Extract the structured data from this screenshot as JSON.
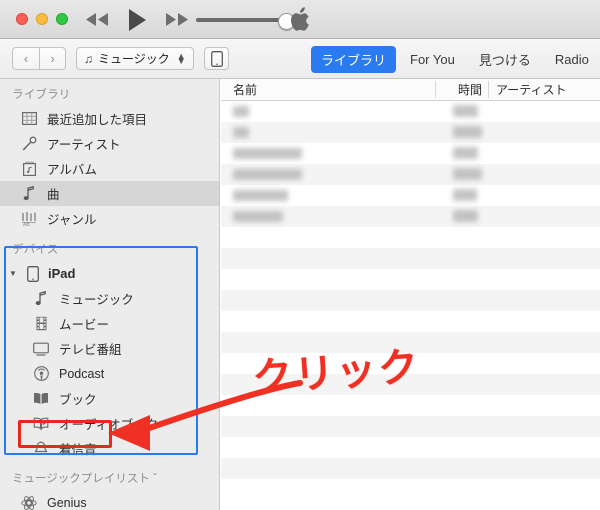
{
  "window": {
    "traffic_lights": [
      {
        "name": "close",
        "color": "#fb5f57"
      },
      {
        "name": "minimize",
        "color": "#fdbc40"
      },
      {
        "name": "zoom",
        "color": "#33c748"
      }
    ],
    "transport": [
      {
        "name": "rewind",
        "icon": "rewind-icon"
      },
      {
        "name": "play",
        "icon": "play-icon"
      },
      {
        "name": "fast-forward",
        "icon": "fast-forward-icon"
      }
    ],
    "volume": {
      "value": 100,
      "label": "volume-slider"
    },
    "apple_logo": ""
  },
  "toolbar": {
    "back_label": "‹",
    "forward_label": "›",
    "source_popup": {
      "label": "ミュージック",
      "icon": "music-note-icon"
    },
    "device_button_icon": "ipad-icon",
    "tabs": [
      {
        "label": "ライブラリ",
        "active": true
      },
      {
        "label": "For You",
        "active": false
      },
      {
        "label": "見つける",
        "active": false
      },
      {
        "label": "Radio",
        "active": false
      }
    ],
    "accent_color": "#2a7bf0"
  },
  "sidebar": {
    "library_header": "ライブラリ",
    "library_items": [
      {
        "label": "最近追加した項目",
        "icon": "grid-icon",
        "selected": false
      },
      {
        "label": "アーティスト",
        "icon": "microphone-icon",
        "selected": false
      },
      {
        "label": "アルバム",
        "icon": "album-icon",
        "selected": false
      },
      {
        "label": "曲",
        "icon": "music-note-icon",
        "selected": true
      },
      {
        "label": "ジャンル",
        "icon": "genre-icon",
        "selected": false
      }
    ],
    "devices_header": "デバイス",
    "device": {
      "label": "iPad",
      "icon": "ipad-icon",
      "expanded": true
    },
    "device_items": [
      {
        "label": "ミュージック",
        "icon": "music-note-icon",
        "highlighted": false
      },
      {
        "label": "ムービー",
        "icon": "film-icon",
        "highlighted": false
      },
      {
        "label": "テレビ番組",
        "icon": "tv-icon",
        "highlighted": false
      },
      {
        "label": "Podcast",
        "icon": "podcast-icon",
        "highlighted": false
      },
      {
        "label": "ブック",
        "icon": "book-icon",
        "highlighted": false
      },
      {
        "label": "オーディオブック",
        "icon": "audiobook-icon",
        "highlighted": false
      },
      {
        "label": "着信音",
        "icon": "bell-icon",
        "highlighted": true
      }
    ],
    "playlists_header": "ミュージックプレイリスト ˇ",
    "playlist_items": [
      {
        "label": "Genius",
        "icon": "genius-icon"
      }
    ]
  },
  "main": {
    "columns": [
      {
        "label": "名前",
        "key": "name"
      },
      {
        "label": "時間",
        "key": "time"
      },
      {
        "label": "アーティスト",
        "key": "artist"
      }
    ],
    "rows": [
      {
        "name_w": 18,
        "time_w": 26,
        "redacted": true
      },
      {
        "name_w": 18,
        "time_w": 30,
        "redacted": true
      },
      {
        "name_w": 70,
        "time_w": 26,
        "redacted": true
      },
      {
        "name_w": 70,
        "time_w": 30,
        "redacted": true
      },
      {
        "name_w": 56,
        "time_w": 24,
        "redacted": true
      },
      {
        "name_w": 50,
        "time_w": 26,
        "redacted": true
      }
    ]
  },
  "annotation": {
    "text": "クリック",
    "color": "#f03022",
    "selection_box_color": "#2a7bf0",
    "target_box_color": "#e8291c",
    "arrow": "curved-arrow-pointing-left"
  }
}
